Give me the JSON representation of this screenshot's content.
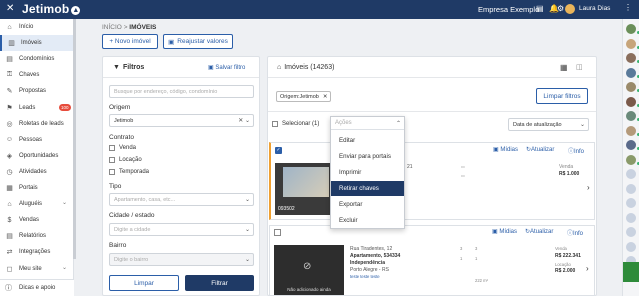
{
  "topbar": {
    "brand": "Jetimob",
    "company": "Empresa Exemplo",
    "user_name": "Laura Dias",
    "icons": [
      "menu-icon",
      "chat-icon",
      "bell-icon",
      "settings-icon",
      "more-icon"
    ]
  },
  "sidebar": {
    "items": [
      {
        "label": "Início",
        "icon": "home-icon"
      },
      {
        "label": "Imóveis",
        "icon": "building-icon",
        "active": true
      },
      {
        "label": "Condomínios",
        "icon": "condo-icon"
      },
      {
        "label": "Chaves",
        "icon": "key-icon"
      },
      {
        "label": "Propostas",
        "icon": "proposal-icon"
      },
      {
        "label": "Leads",
        "icon": "leads-icon",
        "badge": "100"
      },
      {
        "label": "Roletas de leads",
        "icon": "roulette-icon"
      },
      {
        "label": "Pessoas",
        "icon": "people-icon"
      },
      {
        "label": "Oportunidades",
        "icon": "opportunity-icon"
      },
      {
        "label": "Atividades",
        "icon": "activity-icon"
      },
      {
        "label": "Portais",
        "icon": "portal-icon"
      },
      {
        "label": "Aluguéis",
        "icon": "rent-icon",
        "chevron": true
      },
      {
        "label": "Vendas",
        "icon": "sales-icon"
      },
      {
        "label": "Relatórios",
        "icon": "report-icon"
      },
      {
        "label": "Integrações",
        "icon": "integration-icon"
      },
      {
        "label": "Meu site",
        "icon": "site-icon",
        "chevron": true
      }
    ],
    "footer": "Dicas e apoio"
  },
  "breadcrumb": {
    "root": "INÍCIO",
    "sep": ">",
    "current": "IMÓVEIS"
  },
  "toolbar": {
    "new_label": "+ Novo imóvel",
    "adjust_label": "Reajustar valores"
  },
  "filters": {
    "title": "Filtros",
    "save_label": "Salvar filtro",
    "search_placeholder": "Busque por endereço, código, condomínio",
    "origin_label": "Origem",
    "origin_value": "Jetimob",
    "contract_label": "Contrato",
    "contract_options": [
      "Venda",
      "Locação",
      "Temporada"
    ],
    "type_label": "Tipo",
    "type_placeholder": "Apartamento, casa, etc...",
    "city_label": "Cidade / estado",
    "city_placeholder": "Digite a cidade",
    "district_label": "Bairro",
    "district_placeholder": "Digite o bairro",
    "clear_label": "Limpar",
    "filter_label": "Filtrar"
  },
  "main": {
    "title": "Imóveis (14263)",
    "chip": "Origem:Jetimob",
    "clear_filters": "Limpar filtros",
    "select_label": "Selecionar (1)",
    "actions_placeholder": "Ações",
    "sort_value": "Data de atualização",
    "actions_menu": [
      "Editar",
      "Enviar para portais",
      "Imprimir",
      "Retirar chaves",
      "Exportar",
      "Excluir"
    ],
    "highlighted_action": "Retirar chaves"
  },
  "cards": [
    {
      "code": "093502",
      "media": "Mídias",
      "update": "Atualizar",
      "info": "Info",
      "address_fragment": "21",
      "price_label": "Venda",
      "price": "R$ 1.000"
    },
    {
      "media": "Mídias",
      "update": "Atualizar",
      "info": "Info",
      "street": "Rua Tiradentes, 12",
      "unit": "Apartamento, 534334",
      "district": "Independência",
      "city": "Porto Alegre - RS",
      "link": "teste teste teste",
      "specs": [
        "3",
        "3",
        "1",
        "1",
        "222 m²"
      ],
      "sale_label": "Venda",
      "sale_price": "R$ 222.341",
      "rent_label": "Locação",
      "rent_price": "R$ 2.000",
      "no_photo": "Não adicionado ainda"
    }
  ],
  "colors": {
    "primary": "#1f3a66",
    "accent": "#2b5ea8",
    "badge": "#e74c3c",
    "selected": "#f0a030"
  }
}
